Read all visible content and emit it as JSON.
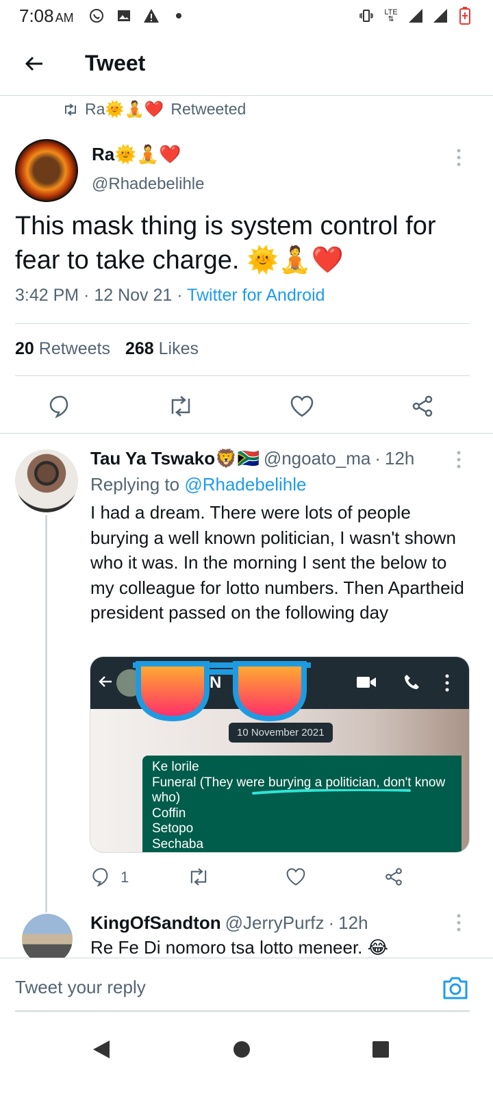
{
  "status_bar": {
    "time": "7:08",
    "ampm": "AM",
    "network": "LTE",
    "icons_left": [
      "whatsapp-icon",
      "gallery-icon",
      "warning-icon",
      "dot-icon"
    ],
    "icons_right": [
      "vibrate-icon",
      "lte-icon",
      "signal-icon",
      "signal-icon",
      "battery-icon"
    ]
  },
  "header": {
    "title": "Tweet",
    "back_icon": "arrow-left-icon"
  },
  "retweet_banner": {
    "name": "Ra🌞🧘❤️",
    "suffix": "Retweeted"
  },
  "tweet": {
    "author_name": "Ra🌞🧘❤️",
    "handle": "@Rhadebelihle",
    "text": "This mask thing is system control for fear to take charge. 🌞🧘❤️",
    "time": "3:42 PM",
    "date": "12 Nov 21",
    "source": "Twitter for Android",
    "retweets": "20",
    "retweets_label": "Retweets",
    "likes": "268",
    "likes_label": "Likes"
  },
  "reply": {
    "author_name": "Tau Ya Tswako🦁🇿🇦",
    "handle": "@ngoato_ma",
    "time": "12h",
    "replying_prefix": "Replying to",
    "replying_to": "@Rhadebelihle",
    "text": "I had a dream. There were lots of people burying a well known politician, I wasn't shown who it was. In the morning I sent the below to my colleague for lotto numbers. Then Apartheid president passed on the following day",
    "reply_count": "1",
    "media": {
      "header_initial": "N",
      "date_chip": "10 November 2021",
      "message_lines": [
        "Ke lorile",
        "Funeral (They were burying a politician, don't know who)",
        "Coffin",
        "Setopo",
        "Sechaba"
      ]
    }
  },
  "reply2": {
    "author_name": "KingOfSandton",
    "handle": "@JerryPurfz",
    "time": "12h",
    "text": "Re Fe Di nomoro tsa lotto meneer. 😂"
  },
  "composer": {
    "placeholder": "Tweet your reply"
  },
  "colors": {
    "accent": "#1d9bf0",
    "muted": "#536471",
    "text": "#0f1419",
    "divider": "#cfd9de",
    "whatsapp_bubble": "#005c4b"
  }
}
